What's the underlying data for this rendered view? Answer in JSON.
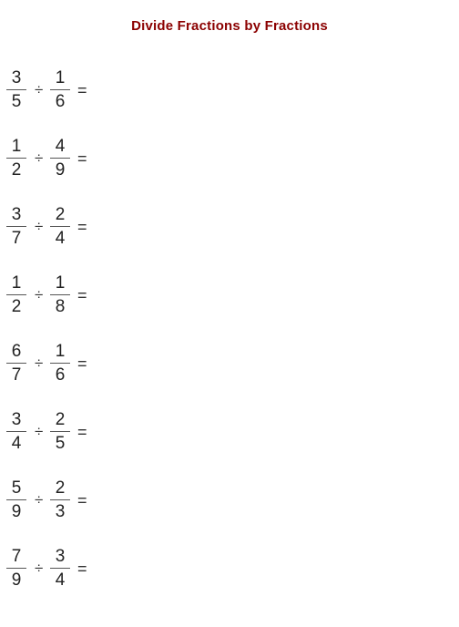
{
  "title": "Divide Fractions by Fractions",
  "operators": {
    "divide": "÷",
    "equals": "="
  },
  "problems": [
    {
      "a": {
        "num": "3",
        "den": "5"
      },
      "b": {
        "num": "1",
        "den": "6"
      }
    },
    {
      "a": {
        "num": "1",
        "den": "2"
      },
      "b": {
        "num": "4",
        "den": "9"
      }
    },
    {
      "a": {
        "num": "3",
        "den": "7"
      },
      "b": {
        "num": "2",
        "den": "4"
      }
    },
    {
      "a": {
        "num": "1",
        "den": "2"
      },
      "b": {
        "num": "1",
        "den": "8"
      }
    },
    {
      "a": {
        "num": "6",
        "den": "7"
      },
      "b": {
        "num": "1",
        "den": "6"
      }
    },
    {
      "a": {
        "num": "3",
        "den": "4"
      },
      "b": {
        "num": "2",
        "den": "5"
      }
    },
    {
      "a": {
        "num": "5",
        "den": "9"
      },
      "b": {
        "num": "2",
        "den": "3"
      }
    },
    {
      "a": {
        "num": "7",
        "den": "9"
      },
      "b": {
        "num": "3",
        "den": "4"
      }
    }
  ]
}
